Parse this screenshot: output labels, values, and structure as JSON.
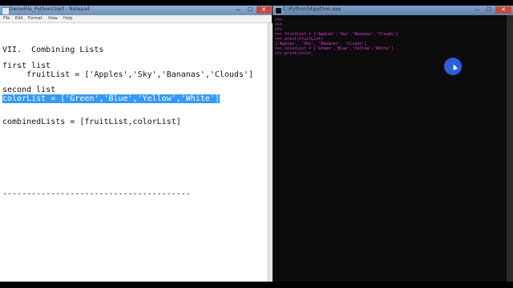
{
  "notepad": {
    "title": "DemoFile_PythonChart - Notepad",
    "controls": {
      "minimize": "—",
      "maximize": "☐",
      "close": "✕"
    },
    "menu": [
      "File",
      "Edit",
      "Format",
      "View",
      "Help"
    ],
    "lines": {
      "heading": "VII.  Combining Lists",
      "first_label": "first list",
      "fruit": "     fruitList = ['Apples','Sky','Bananas','Clouds']",
      "second_label": "second list",
      "color": "colorList = ['Green','Blue','Yellow','White']",
      "combined": "combinedLists = [fruitList,colorList]",
      "divider": "---------------------------------------"
    }
  },
  "console": {
    "title": "C:\\Python34\\python.exe",
    "controls": {
      "minimize": "—",
      "maximize": "☐",
      "close": "✕"
    },
    "lines": [
      ">>>",
      ">>>",
      ">>>",
      ">>> fruitList = ['Apples','Sky','Bananas','Clouds']",
      ">>> print(fruitList)",
      "['Apples', 'Sky', 'Bananas', 'Clouds']",
      ">>> colorList = ['Green','Blue','Yellow','White']",
      ">>> print(color_"
    ]
  }
}
